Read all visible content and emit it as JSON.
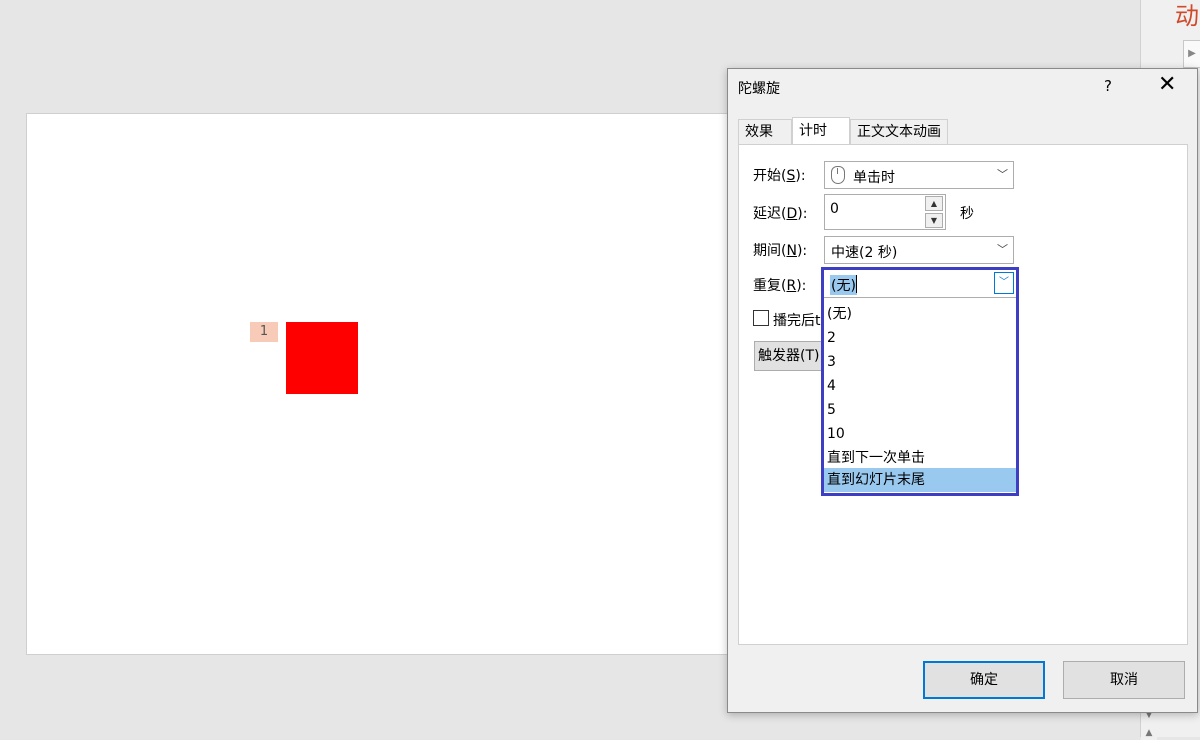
{
  "right_panel": {
    "heading": "动",
    "play_icon": "▶"
  },
  "slide": {
    "animation_tag": "1"
  },
  "dialog": {
    "title": "陀螺旋",
    "help": "?",
    "close": "✕",
    "tabs": [
      {
        "label": "效果"
      },
      {
        "label": "计时"
      },
      {
        "label": "正文文本动画"
      }
    ],
    "timing": {
      "start_label_pre": "开始(",
      "start_label_key": "S",
      "start_label_post": "):",
      "start_value": "单击时",
      "delay_label_pre": "延迟(",
      "delay_label_key": "D",
      "delay_label_post": "):",
      "delay_value": "0",
      "delay_unit": "秒",
      "duration_label_pre": "期间(",
      "duration_label_key": "N",
      "duration_label_post": "):",
      "duration_value": "中速(2 秒)",
      "repeat_label_pre": "重复(",
      "repeat_label_key": "R",
      "repeat_label_post": "):",
      "repeat_value": "(无)",
      "rewind_label": "播完后t",
      "trigger_label": "触发器(T)"
    },
    "repeat_options": [
      "(无)",
      "2",
      "3",
      "4",
      "5",
      "10",
      "直到下一次单击",
      "直到幻灯片末尾"
    ],
    "ok_label": "确定",
    "cancel_label": "取消"
  }
}
